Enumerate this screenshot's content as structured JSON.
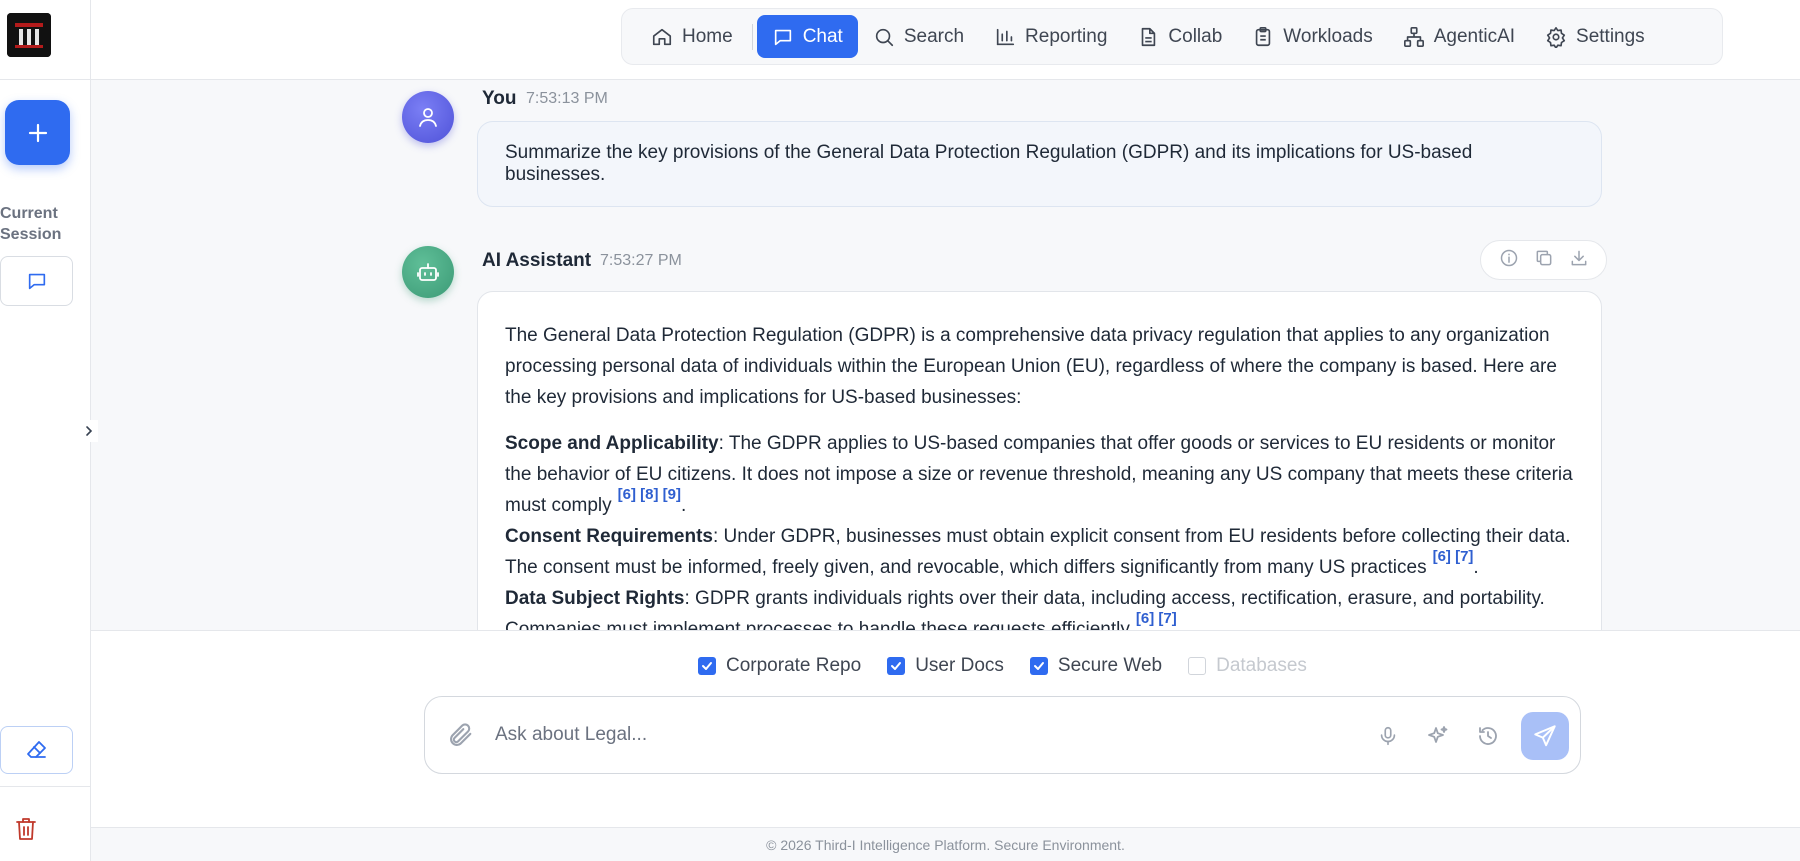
{
  "sidebar": {
    "current_session_label": "Current Session"
  },
  "nav": {
    "items": [
      {
        "label": "Home",
        "icon": "home-icon"
      },
      {
        "label": "Chat",
        "icon": "chat-icon",
        "active": true
      },
      {
        "label": "Search",
        "icon": "search-icon"
      },
      {
        "label": "Reporting",
        "icon": "bar-chart-icon"
      },
      {
        "label": "Collab",
        "icon": "document-icon"
      },
      {
        "label": "Workloads",
        "icon": "clipboard-icon"
      },
      {
        "label": "AgenticAI",
        "icon": "network-icon"
      },
      {
        "label": "Settings",
        "icon": "gear-icon"
      }
    ]
  },
  "chat": {
    "user": {
      "sender": "You",
      "time": "7:53:13 PM",
      "text": "Summarize the key provisions of the General Data Protection Regulation (GDPR) and its implications for US-based businesses."
    },
    "assistant": {
      "sender": "AI Assistant",
      "time": "7:53:27 PM",
      "intro": "The General Data Protection Regulation (GDPR) is a comprehensive data privacy regulation that applies to any organization processing personal data of individuals within the European Union (EU), regardless of where the company is based. Here are the key provisions and implications for US-based businesses:",
      "points": [
        {
          "title": "Scope and Applicability",
          "text": ": The GDPR applies to US-based companies that offer goods or services to EU residents or monitor the behavior of EU citizens. It does not impose a size or revenue threshold, meaning any US company that meets these criteria must comply",
          "cites": "[6] [8] [9]",
          "end": "."
        },
        {
          "title": "Consent Requirements",
          "text": ": Under GDPR, businesses must obtain explicit consent from EU residents before collecting their data. The consent must be informed, freely given, and revocable, which differs significantly from many US practices",
          "cites": "[6] [7]",
          "end": "."
        },
        {
          "title": "Data Subject Rights",
          "text": ": GDPR grants individuals rights over their data, including access, rectification, erasure, and portability. Companies must implement processes to handle these requests efficiently",
          "cites": "[6] [7]",
          "end": "."
        }
      ]
    }
  },
  "composer": {
    "sources": [
      {
        "label": "Corporate Repo",
        "checked": true
      },
      {
        "label": "User Docs",
        "checked": true
      },
      {
        "label": "Secure Web",
        "checked": true
      },
      {
        "label": "Databases",
        "checked": false,
        "disabled": true
      }
    ],
    "placeholder": "Ask about Legal...",
    "value": ""
  },
  "footer": {
    "text": "© 2026 Third-I Intelligence Platform. Secure Environment."
  },
  "colors": {
    "accent": "#2f6bf0",
    "user_avatar": "#5b5fe3",
    "ai_avatar": "#45a883",
    "citation": "#2f5fd0",
    "danger": "#c0392b"
  }
}
